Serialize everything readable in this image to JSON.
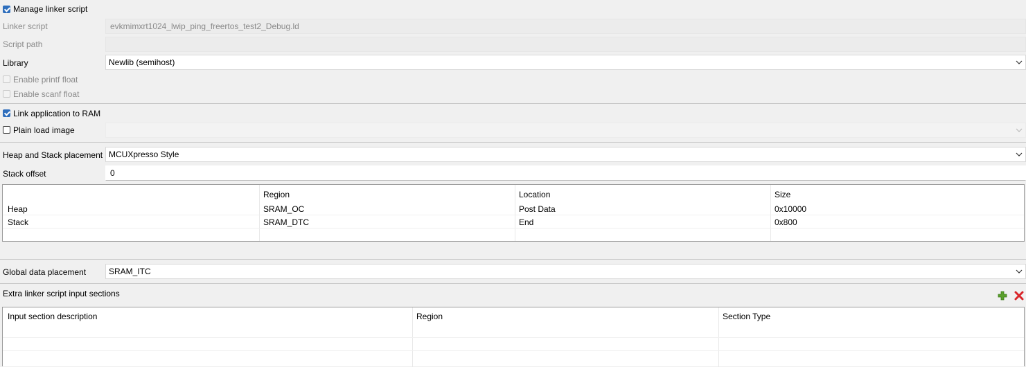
{
  "manage_linker_script": {
    "label": "Manage linker script",
    "checked": true
  },
  "linker_script": {
    "label": "Linker script",
    "value": "evkmimxrt1024_lwip_ping_freertos_test2_Debug.ld"
  },
  "script_path": {
    "label": "Script path",
    "value": ""
  },
  "library": {
    "label": "Library",
    "value": "Newlib (semihost)"
  },
  "enable_printf_float": {
    "label": "Enable printf float",
    "checked": false,
    "enabled": false
  },
  "enable_scanf_float": {
    "label": "Enable scanf float",
    "checked": false,
    "enabled": false
  },
  "link_app_to_ram": {
    "label": "Link application to RAM",
    "checked": true
  },
  "plain_load_image": {
    "label": "Plain load image",
    "checked": false,
    "value": ""
  },
  "heap_stack_placement": {
    "label": "Heap and Stack placement",
    "value": "MCUXpresso Style"
  },
  "stack_offset": {
    "label": "Stack offset",
    "value": "0"
  },
  "heap_stack_table": {
    "headers": [
      "",
      "Region",
      "Location",
      "Size"
    ],
    "rows": [
      [
        "Heap",
        "SRAM_OC",
        "Post Data",
        "0x10000"
      ],
      [
        "Stack",
        "SRAM_DTC",
        "End",
        "0x800"
      ]
    ]
  },
  "global_data_placement": {
    "label": "Global data placement",
    "value": "SRAM_ITC"
  },
  "extra_sections": {
    "label": "Extra linker script input sections",
    "headers": [
      "Input section description",
      "Region",
      "Section Type"
    ],
    "add_icon": "plus-icon",
    "remove_icon": "red-x-icon"
  },
  "colors": {
    "checkbox_accent": "#2f6fbd",
    "add_green": "#5aa02c",
    "remove_red": "#d9252a"
  }
}
